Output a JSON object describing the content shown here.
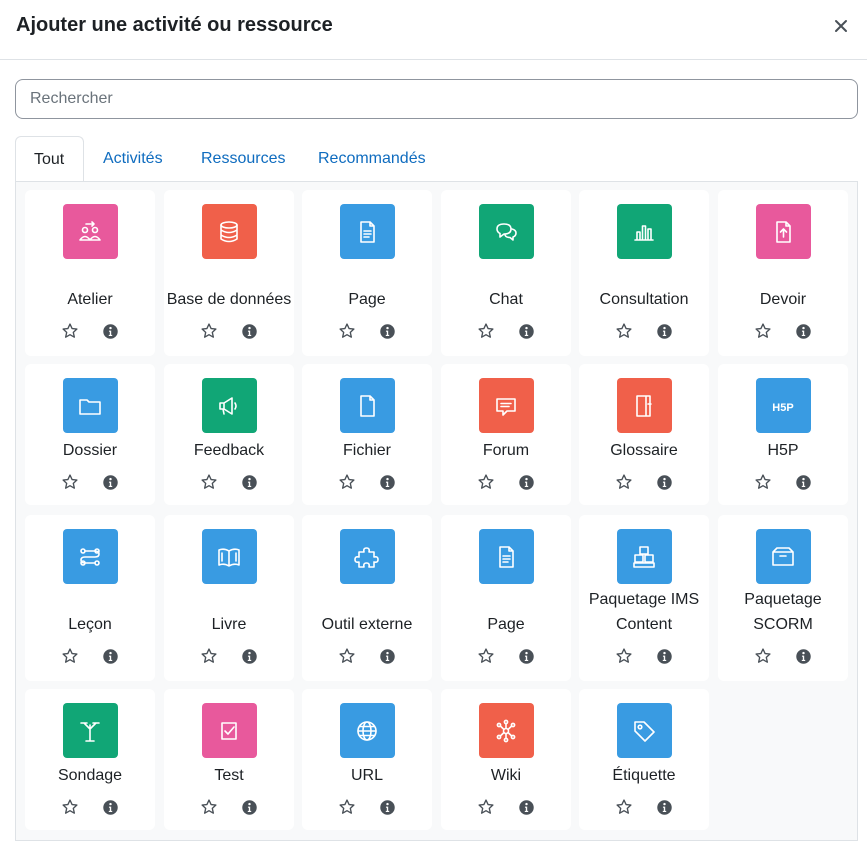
{
  "dialog": {
    "title": "Ajouter une activité ou ressource"
  },
  "search": {
    "placeholder": "Rechercher"
  },
  "tabs": [
    {
      "label": "Tout",
      "active": true
    },
    {
      "label": "Activités"
    },
    {
      "label": "Ressources"
    },
    {
      "label": "Recommandés"
    }
  ],
  "colors": {
    "pink": "#e8599c",
    "red": "#f0604a",
    "blue": "#399be2",
    "green": "#11a676",
    "link": "#0f6cbf"
  },
  "modules": [
    {
      "name": "Atelier",
      "icon": "workshop-icon",
      "color": "pink"
    },
    {
      "name": "Base de données",
      "icon": "database-icon",
      "color": "red"
    },
    {
      "name": "Page",
      "icon": "page-icon",
      "color": "blue"
    },
    {
      "name": "Chat",
      "icon": "chat-icon",
      "color": "green"
    },
    {
      "name": "Consultation",
      "icon": "bar-chart-icon",
      "color": "green"
    },
    {
      "name": "Devoir",
      "icon": "assignment-icon",
      "color": "pink"
    },
    {
      "name": "Dossier",
      "icon": "folder-icon",
      "color": "blue"
    },
    {
      "name": "Feedback",
      "icon": "megaphone-icon",
      "color": "green"
    },
    {
      "name": "Fichier",
      "icon": "file-icon",
      "color": "blue"
    },
    {
      "name": "Forum",
      "icon": "forum-icon",
      "color": "red"
    },
    {
      "name": "Glossaire",
      "icon": "glossary-icon",
      "color": "red"
    },
    {
      "name": "H5P",
      "icon": "h5p-icon",
      "color": "blue"
    },
    {
      "name": "Leçon",
      "icon": "lesson-icon",
      "color": "blue"
    },
    {
      "name": "Livre",
      "icon": "book-icon",
      "color": "blue"
    },
    {
      "name": "Outil externe",
      "icon": "puzzle-icon",
      "color": "blue"
    },
    {
      "name": "Page",
      "icon": "page-icon",
      "color": "blue"
    },
    {
      "name": "Paquetage IMS Content",
      "icon": "ims-package-icon",
      "color": "blue"
    },
    {
      "name": "Paquetage SCORM",
      "icon": "scorm-package-icon",
      "color": "blue"
    },
    {
      "name": "Sondage",
      "icon": "choice-icon",
      "color": "green"
    },
    {
      "name": "Test",
      "icon": "quiz-icon",
      "color": "pink"
    },
    {
      "name": "URL",
      "icon": "globe-icon",
      "color": "blue"
    },
    {
      "name": "Wiki",
      "icon": "wiki-icon",
      "color": "red"
    },
    {
      "name": "Étiquette",
      "icon": "tag-icon",
      "color": "blue"
    }
  ]
}
